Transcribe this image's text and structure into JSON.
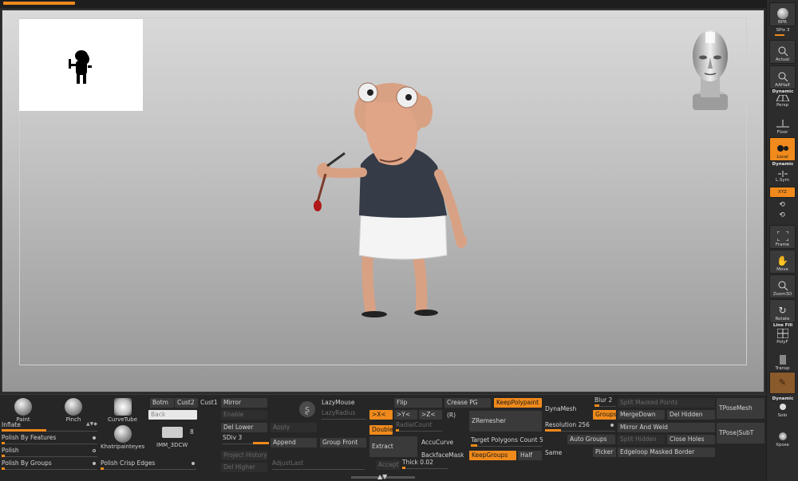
{
  "right_shelf": {
    "bpr": "BPR",
    "spix": "SPix 3",
    "actual": "Actual",
    "aahalf": "AAHalf",
    "dynamic1": "Dynamic",
    "persp": "Persp",
    "floor": "Floor",
    "local": "Local",
    "dynamic2": "Dynamic",
    "lsym": "L.Sym",
    "xyz": "XYZ",
    "frame": "Frame",
    "move": "Move",
    "zoom3d": "Zoom3D",
    "rotate": "Rotate",
    "linefill": "Line Fill",
    "polyf": "PolyF",
    "transp": "Transp",
    "dynamic3": "Dynamic",
    "solo": "Solo",
    "xpose": "Xpose"
  },
  "brushes": {
    "paint": "Paint",
    "pinch": "Pinch",
    "curvetube": "CurveTube",
    "khatri": "Khatripainteyes",
    "imm": "IMM_3DCW",
    "imm_count": "8"
  },
  "inflate": "Inflate",
  "polish_features": "Polish By Features",
  "polish": "Polish",
  "polish_groups": "Polish By Groups",
  "polish_crisp": "Polish Crisp Edges",
  "botm": "Botm",
  "cust2": "Cust2",
  "cust1": "Cust1",
  "back": "Back",
  "mirror": "Mirror",
  "enable": "Enable",
  "del_lower": "Del Lower",
  "apply": "Apply",
  "sdiv": "SDiv 3",
  "append": "Append",
  "group_front": "Group Front",
  "project_history": "Project History",
  "del_higher": "Del Higher",
  "adjust_last": "AdjustLast",
  "lazymouse": "LazyMouse",
  "lazyradius": "LazyRadius",
  "flip": "Flip",
  "create_pg": "Crease PG",
  "keep_polypaint": "KeepPolypaint",
  "sym_x": ">X<",
  "sym_y": ">Y<",
  "sym_z": ">Z<",
  "sym_r": "(R)",
  "double": "Double",
  "radial_count": "RadialCount",
  "extract": "Extract",
  "accucurve": "AccuCurve",
  "backface_mask": "BackfaceMask",
  "accept": "Accept",
  "thick": "Thick 0.02",
  "zremesher": "ZRemesher",
  "target_polygons": "Target Polygons Count 5",
  "keep_groups": "KeepGroups",
  "half": "Half",
  "dynamesh": "DynaMesh",
  "resolution": "Resolution 256",
  "auto_groups": "Auto Groups",
  "same": "Same",
  "blur": "Blur 2",
  "groups": "Groups",
  "picker": "Picker",
  "split_masked": "Split Masked Points",
  "merge_down": "MergeDown",
  "del_hidden": "Del Hidden",
  "mirror_weld": "Mirror And Weld",
  "split_hidden": "Split Hidden",
  "close_holes": "Close Holes",
  "edgeloop": "Edgeloop Masked Border",
  "tpose_mesh": "TPoseMesh",
  "tpose_subt": "TPose|SubT",
  "colors": {
    "accent": "#f08a1c",
    "button": "#3a3a3a",
    "panel": "#262626"
  }
}
